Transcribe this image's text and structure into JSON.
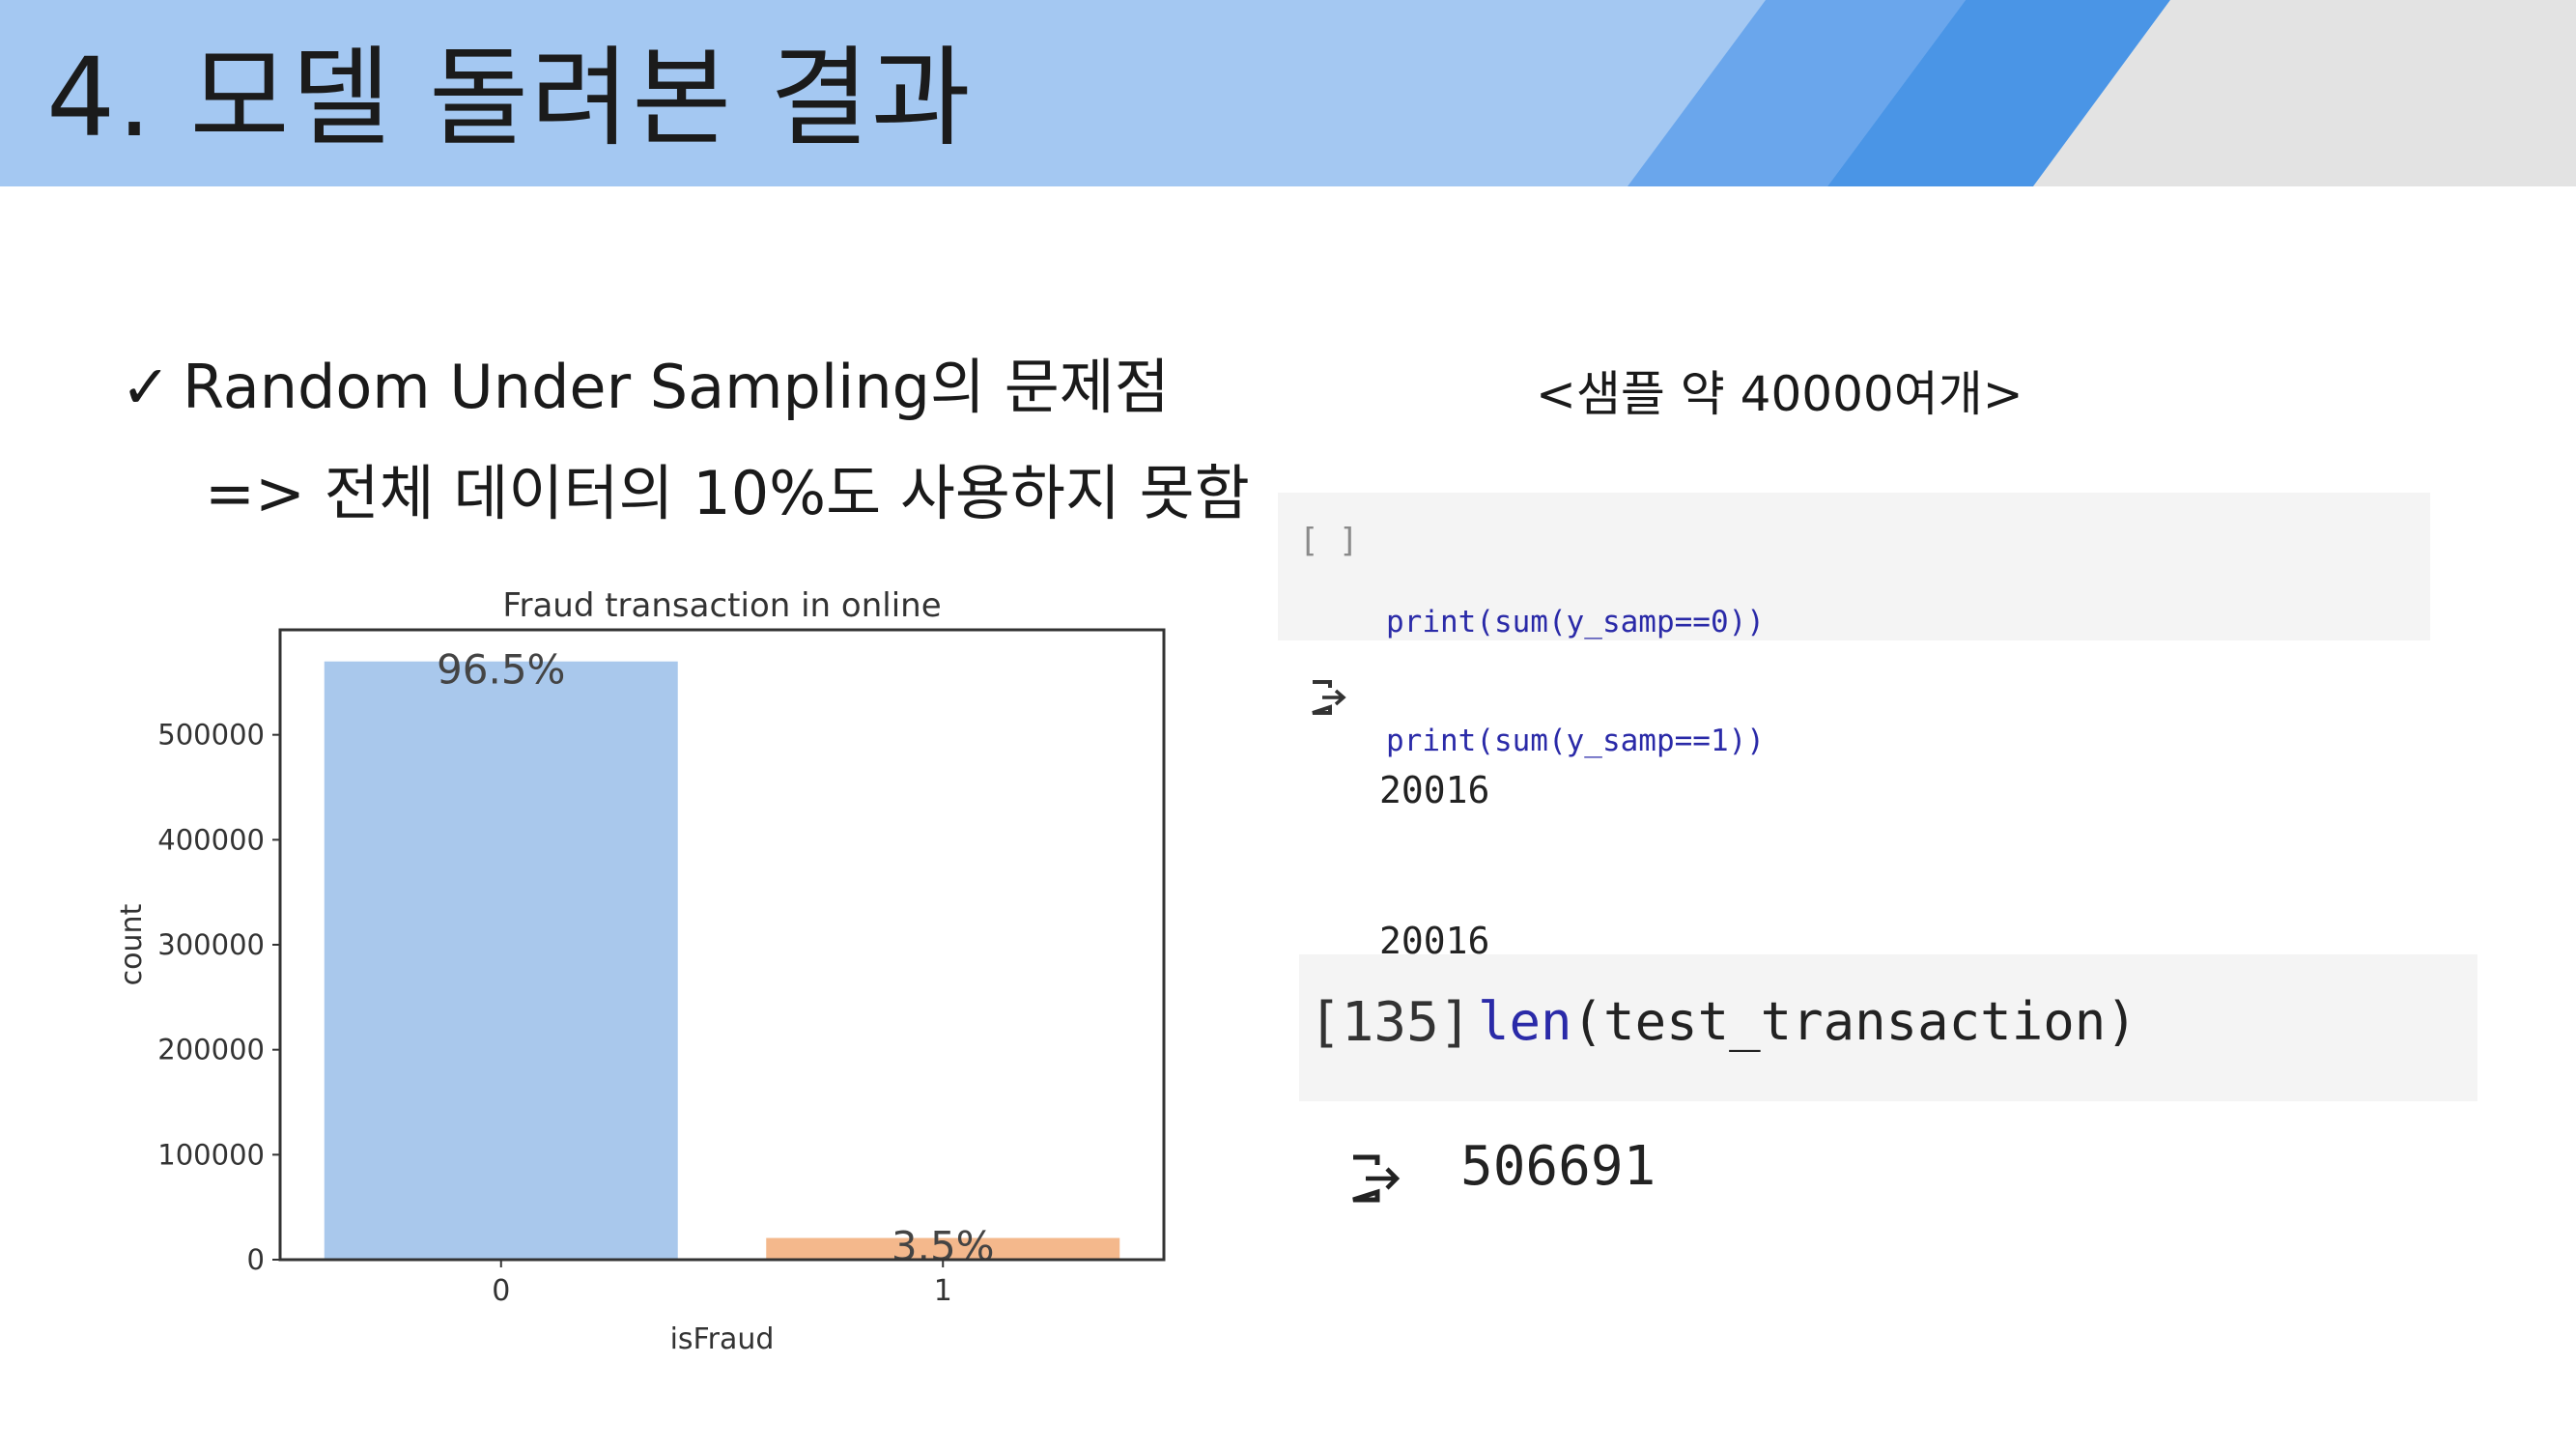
{
  "slide": {
    "title": "4. 모델 돌려본 결과",
    "bullet": "Random Under Sampling의 문제점",
    "check_glyph": "✓",
    "sub_point": "=> 전체 데이터의 10%도 사용하지 못함",
    "sample_note": "<샘플 약 40000여개>"
  },
  "colors": {
    "header_light": "#a4c8f2",
    "header_mid": "#6aa6ec",
    "header_dark": "#4a95e6",
    "header_gray": "#e3e3e3",
    "bar_0": "#a9c8ec",
    "bar_1": "#f4b88c"
  },
  "chart_data": {
    "type": "bar",
    "title": "Fraud transaction in online",
    "xlabel": "isFraud",
    "ylabel": "count",
    "categories": [
      "0",
      "1"
    ],
    "values": [
      569877,
      20663
    ],
    "data_labels": [
      "96.5%",
      "3.5%"
    ],
    "ylim": [
      0,
      600000
    ],
    "yticks": [
      0,
      100000,
      200000,
      300000,
      400000,
      500000
    ],
    "ytick_labels": [
      "0",
      "100000",
      "200000",
      "300000",
      "400000",
      "500000"
    ],
    "grid": false
  },
  "notebook": {
    "cell1": {
      "prompt": "[ ]",
      "lines": [
        "print(sum(y_samp==0))",
        "print(sum(y_samp==1))"
      ],
      "output": [
        "20016",
        "20016"
      ],
      "output_icon": "output-arrow-icon"
    },
    "cell2": {
      "prompt": "[135]",
      "code_fn": "len",
      "code_arg": "(test_transaction)",
      "output": "506691",
      "output_icon": "output-arrow-icon"
    }
  }
}
